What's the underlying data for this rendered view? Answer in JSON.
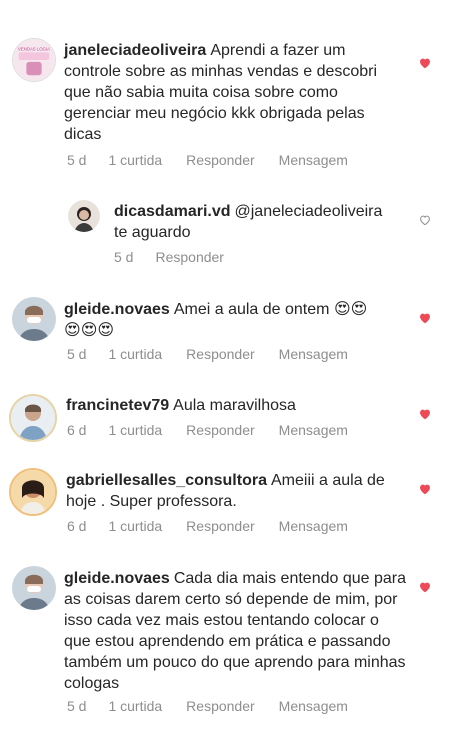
{
  "actions": {
    "curtida": "1 curtida",
    "reply": "Responder",
    "message": "Mensagem"
  },
  "emoji": "😍",
  "comments": [
    {
      "username": "janeleciadeoliveira",
      "text": "Aprendi a fazer um controle sobre as minhas vendas e descobri que não sabia muita coisa sobre como gerenciar meu negócio kkk obrigada pelas dicas",
      "time": "5 d",
      "avatar_text": "VENDAS LOGIA"
    },
    {
      "username": "dicasdamari.vd",
      "mention": "@janeleciadeoliveira",
      "text": "te aguardo",
      "time": "5 d"
    },
    {
      "username": "gleide.novaes",
      "text": "Amei a aula de ontem",
      "time": "5 d"
    },
    {
      "username": "francinetev79",
      "text": "Aula maravilhosa",
      "time": "6 d"
    },
    {
      "username": "gabriellesalles_consultora",
      "text": "Ameiii a aula de hoje . Super professora.",
      "time": "6 d"
    },
    {
      "username": "gleide.novaes",
      "text": "Cada dia mais entendo que para as coisas darem certo só depende de mim, por isso cada vez mais estou tentando colocar o que estou aprendendo em prática e passando também um pouco do que aprendo para minhas cologas",
      "time": "5 d"
    }
  ],
  "colors": {
    "like_filled": "#ed4956",
    "like_outline": "#8e8e8e",
    "meta": "#8e8e8e"
  }
}
